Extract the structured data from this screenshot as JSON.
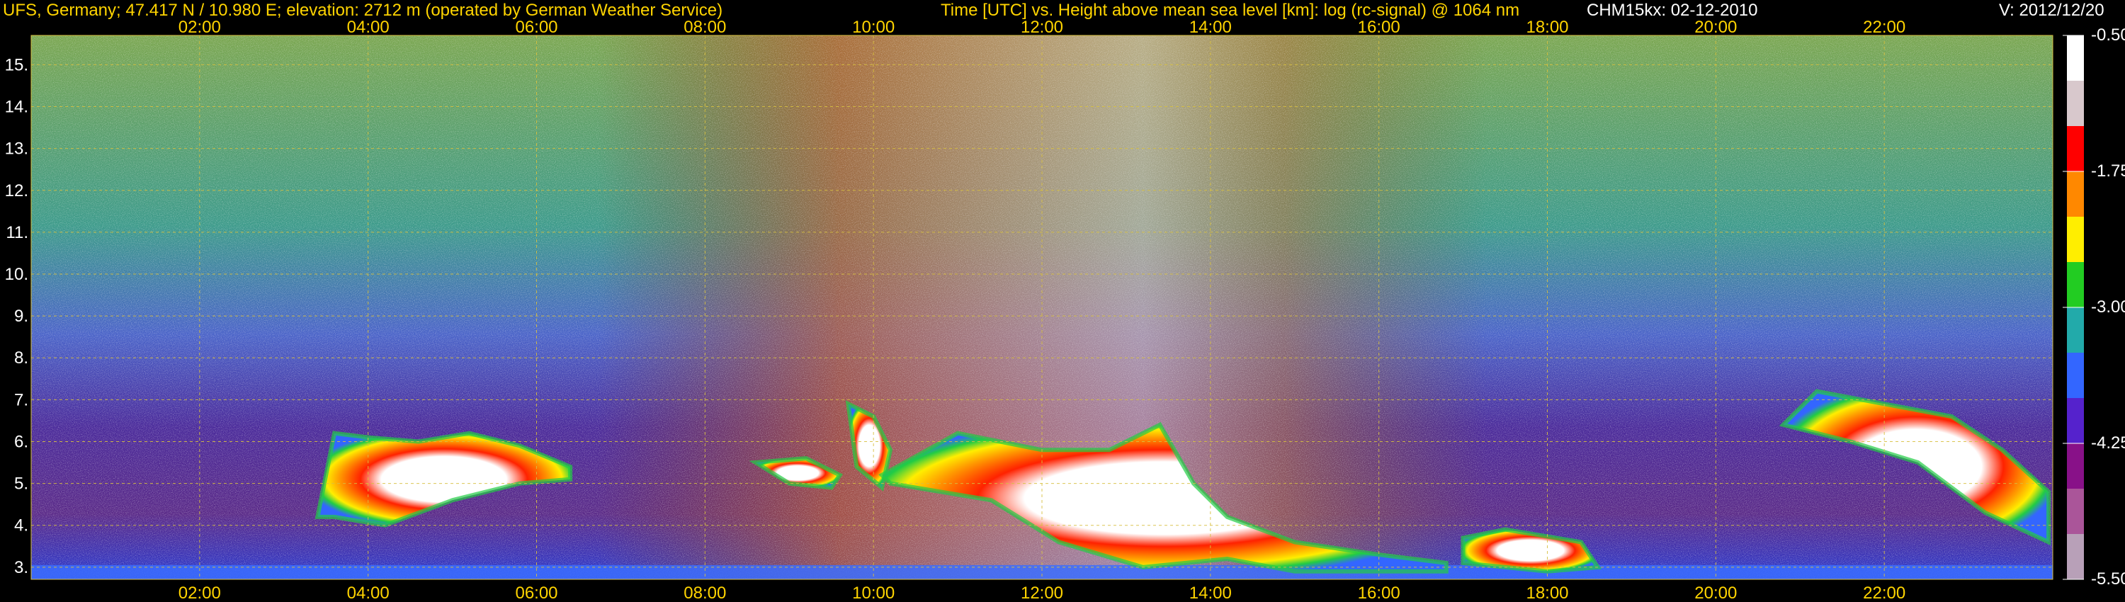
{
  "header": {
    "site": "UFS, Germany; 47.417 N / 10.980 E; elevation: 2712 m  (operated by German Weather Service)",
    "title": "Time [UTC] vs. Height above mean sea level [km]: log (rc-signal) @ 1064 nm",
    "instrument": "CHM15kx: 02-12-2010",
    "version": "V: 2012/12/20"
  },
  "chart_data": {
    "type": "heatmap",
    "title": "Time [UTC] vs. Height above mean sea level [km]: log (rc-signal) @ 1064 nm",
    "xlabel": "Time [UTC]",
    "ylabel": "Height above mean sea level [km]",
    "xlim": [
      0,
      24
    ],
    "ylim": [
      2.71,
      15.7
    ],
    "x_ticks": [
      "02:00",
      "04:00",
      "06:00",
      "08:00",
      "10:00",
      "12:00",
      "14:00",
      "16:00",
      "18:00",
      "20:00",
      "22:00"
    ],
    "x_tick_values": [
      2,
      4,
      6,
      8,
      10,
      12,
      14,
      16,
      18,
      20,
      22
    ],
    "y_ticks": [
      "3.",
      "4.",
      "5.",
      "6.",
      "7.",
      "8.",
      "9.",
      "10.",
      "11.",
      "12.",
      "13.",
      "14.",
      "15."
    ],
    "y_tick_values": [
      3,
      4,
      5,
      6,
      7,
      8,
      9,
      10,
      11,
      12,
      13,
      14,
      15
    ],
    "grid": true,
    "colorbar": {
      "labels": [
        "-0.50",
        "-1.75",
        "-3.00",
        "-4.25",
        "-5.50"
      ],
      "values": [
        -0.5,
        -1.75,
        -3.0,
        -4.25,
        -5.5
      ],
      "colors": [
        "#ffffff",
        "#d8c8cc",
        "#ff0000",
        "#ff8800",
        "#ffee00",
        "#22cc22",
        "#22aaaa",
        "#3366ff",
        "#5522cc",
        "#881188",
        "#aa5599",
        "#b8a0b8"
      ]
    },
    "layers": [
      {
        "name": "cloud-a",
        "x": [
          3.4,
          3.6,
          4.0,
          4.6,
          5.2,
          5.8,
          6.4,
          6.4,
          5.8,
          5.0,
          4.2,
          3.6,
          3.4
        ],
        "y": [
          4.2,
          6.2,
          6.1,
          6.0,
          6.2,
          5.9,
          5.4,
          5.1,
          5.0,
          4.6,
          4.0,
          4.2,
          4.2
        ]
      },
      {
        "name": "cloud-b",
        "x": [
          8.6,
          9.2,
          9.6,
          9.5,
          9.0,
          8.6
        ],
        "y": [
          5.5,
          5.6,
          5.2,
          4.9,
          5.0,
          5.5
        ]
      },
      {
        "name": "cloud-c",
        "x": [
          9.7,
          10.0,
          10.2,
          10.1,
          9.8,
          9.7
        ],
        "y": [
          6.9,
          6.6,
          5.8,
          4.9,
          5.4,
          6.9
        ]
      },
      {
        "name": "cloud-d",
        "x": [
          10.1,
          11.0,
          12.0,
          12.8,
          13.4,
          13.8,
          14.2,
          15.0,
          16.0,
          16.8,
          16.8,
          15.0,
          14.2,
          13.2,
          12.2,
          11.4,
          10.2,
          10.1
        ],
        "y": [
          5.2,
          6.2,
          5.8,
          5.8,
          6.4,
          5.0,
          4.2,
          3.6,
          3.3,
          3.1,
          2.9,
          2.9,
          3.2,
          3.0,
          3.6,
          4.6,
          5.0,
          5.2
        ]
      },
      {
        "name": "cloud-e",
        "x": [
          17.0,
          17.5,
          18.4,
          18.6,
          18.0,
          17.0,
          17.0
        ],
        "y": [
          3.7,
          3.9,
          3.6,
          3.0,
          2.9,
          3.1,
          3.7
        ]
      },
      {
        "name": "cloud-f",
        "x": [
          20.8,
          21.2,
          22.0,
          22.8,
          23.4,
          23.95,
          23.95,
          23.2,
          22.4,
          21.6,
          20.8
        ],
        "y": [
          6.4,
          7.2,
          6.9,
          6.6,
          5.8,
          4.8,
          3.6,
          4.3,
          5.5,
          6.0,
          6.4
        ]
      }
    ]
  }
}
